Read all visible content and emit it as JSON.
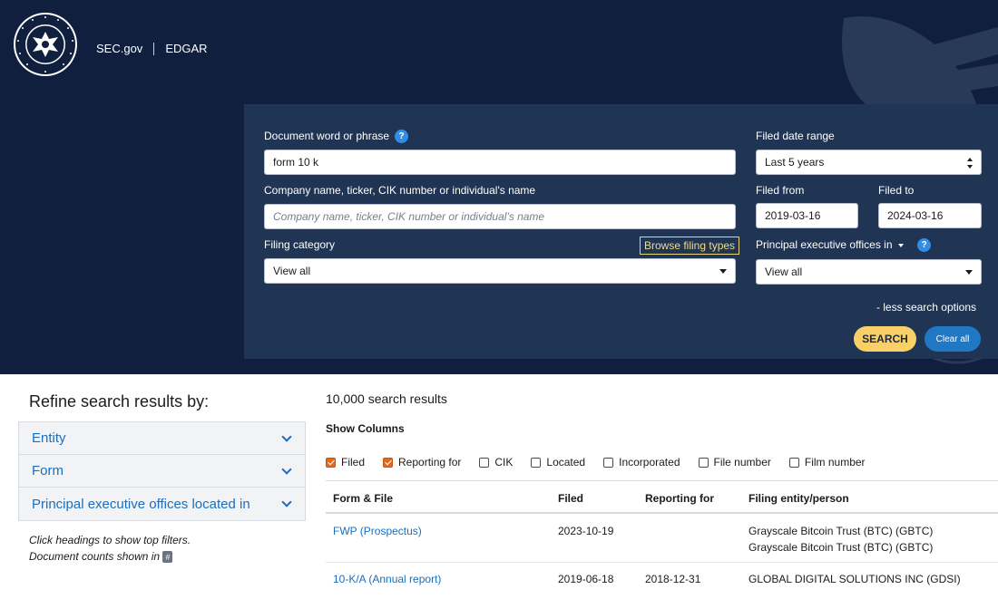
{
  "header": {
    "brand": "SEC.gov",
    "section": "EDGAR",
    "seal": {
      "text": "U.S. SECURITIES AND EXCHANGE COMMISSION · MCMXXXIV"
    }
  },
  "search": {
    "doc_label": "Document word or phrase",
    "doc_help": "?",
    "doc_value": "form 10 k",
    "company_label": "Company name, ticker, CIK number or individual's name",
    "company_placeholder": "Company name, ticker, CIK number or individual's name",
    "category_label": "Filing category",
    "category_value": "View all",
    "browse_label": "Browse filing types",
    "date_range_label": "Filed date range",
    "date_range_value": "Last 5 years",
    "filed_from_label": "Filed from",
    "filed_from_value": "2019-03-16",
    "filed_to_label": "Filed to",
    "filed_to_value": "2024-03-16",
    "offices_label": "Principal executive offices in",
    "offices_help": "?",
    "offices_value": "View all",
    "less_options": "- less search options",
    "search_button": "SEARCH",
    "clear_button": "Clear all"
  },
  "refine": {
    "title": "Refine search results by:",
    "facets": [
      "Entity",
      "Form",
      "Principal executive offices located in"
    ],
    "hint_line1": "Click headings to show top filters.",
    "hint_line2": "Document counts shown in",
    "hint_badge": "#"
  },
  "results": {
    "count": "10,000 search results",
    "show_columns": "Show Columns",
    "column_toggles": [
      {
        "label": "Filed",
        "checked": true
      },
      {
        "label": "Reporting for",
        "checked": true
      },
      {
        "label": "CIK",
        "checked": false
      },
      {
        "label": "Located",
        "checked": false
      },
      {
        "label": "Incorporated",
        "checked": false
      },
      {
        "label": "File number",
        "checked": false
      },
      {
        "label": "Film number",
        "checked": false
      }
    ],
    "headers": [
      "Form & File",
      "Filed",
      "Reporting for",
      "Filing entity/person"
    ],
    "rows": [
      {
        "form": "FWP (Prospectus)",
        "filed": "2023-10-19",
        "reporting": "",
        "entity1": "Grayscale Bitcoin Trust (BTC) (GBTC)",
        "entity2": "Grayscale Bitcoin Trust (BTC) (GBTC)"
      },
      {
        "form": "10-K/A (Annual report)",
        "filed": "2019-06-18",
        "reporting": "2018-12-31",
        "entity1": "GLOBAL DIGITAL SOLUTIONS INC (GDSI)",
        "entity2": ""
      }
    ]
  },
  "colors": {
    "header_bg": "#0f1f3d",
    "panel_bg": "#203554",
    "search_button": "#f8d067",
    "clear_button": "#2077c4",
    "link": "#1a6fbf",
    "checkbox_on": "#e36b1f"
  }
}
